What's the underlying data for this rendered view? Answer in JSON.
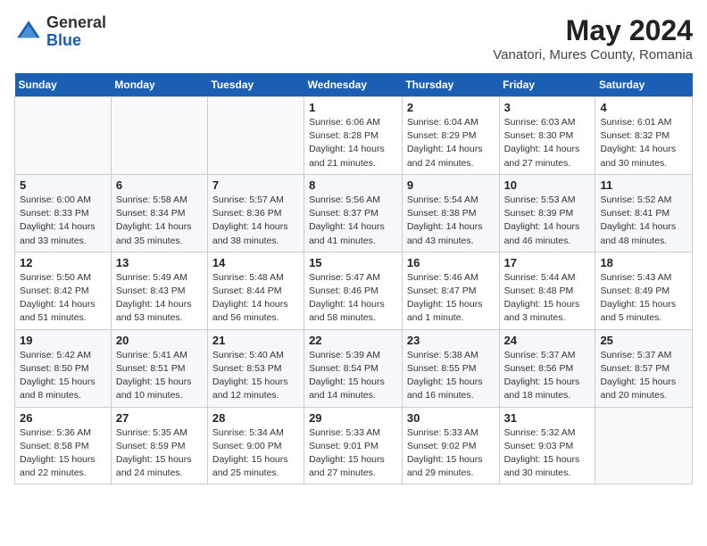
{
  "header": {
    "logo": {
      "general": "General",
      "blue": "Blue"
    },
    "title": "May 2024",
    "location": "Vanatori, Mures County, Romania"
  },
  "weekdays": [
    "Sunday",
    "Monday",
    "Tuesday",
    "Wednesday",
    "Thursday",
    "Friday",
    "Saturday"
  ],
  "weeks": [
    [
      null,
      null,
      null,
      {
        "day": "1",
        "sunrise": "Sunrise: 6:06 AM",
        "sunset": "Sunset: 8:28 PM",
        "daylight": "Daylight: 14 hours and 21 minutes."
      },
      {
        "day": "2",
        "sunrise": "Sunrise: 6:04 AM",
        "sunset": "Sunset: 8:29 PM",
        "daylight": "Daylight: 14 hours and 24 minutes."
      },
      {
        "day": "3",
        "sunrise": "Sunrise: 6:03 AM",
        "sunset": "Sunset: 8:30 PM",
        "daylight": "Daylight: 14 hours and 27 minutes."
      },
      {
        "day": "4",
        "sunrise": "Sunrise: 6:01 AM",
        "sunset": "Sunset: 8:32 PM",
        "daylight": "Daylight: 14 hours and 30 minutes."
      }
    ],
    [
      {
        "day": "5",
        "sunrise": "Sunrise: 6:00 AM",
        "sunset": "Sunset: 8:33 PM",
        "daylight": "Daylight: 14 hours and 33 minutes."
      },
      {
        "day": "6",
        "sunrise": "Sunrise: 5:58 AM",
        "sunset": "Sunset: 8:34 PM",
        "daylight": "Daylight: 14 hours and 35 minutes."
      },
      {
        "day": "7",
        "sunrise": "Sunrise: 5:57 AM",
        "sunset": "Sunset: 8:36 PM",
        "daylight": "Daylight: 14 hours and 38 minutes."
      },
      {
        "day": "8",
        "sunrise": "Sunrise: 5:56 AM",
        "sunset": "Sunset: 8:37 PM",
        "daylight": "Daylight: 14 hours and 41 minutes."
      },
      {
        "day": "9",
        "sunrise": "Sunrise: 5:54 AM",
        "sunset": "Sunset: 8:38 PM",
        "daylight": "Daylight: 14 hours and 43 minutes."
      },
      {
        "day": "10",
        "sunrise": "Sunrise: 5:53 AM",
        "sunset": "Sunset: 8:39 PM",
        "daylight": "Daylight: 14 hours and 46 minutes."
      },
      {
        "day": "11",
        "sunrise": "Sunrise: 5:52 AM",
        "sunset": "Sunset: 8:41 PM",
        "daylight": "Daylight: 14 hours and 48 minutes."
      }
    ],
    [
      {
        "day": "12",
        "sunrise": "Sunrise: 5:50 AM",
        "sunset": "Sunset: 8:42 PM",
        "daylight": "Daylight: 14 hours and 51 minutes."
      },
      {
        "day": "13",
        "sunrise": "Sunrise: 5:49 AM",
        "sunset": "Sunset: 8:43 PM",
        "daylight": "Daylight: 14 hours and 53 minutes."
      },
      {
        "day": "14",
        "sunrise": "Sunrise: 5:48 AM",
        "sunset": "Sunset: 8:44 PM",
        "daylight": "Daylight: 14 hours and 56 minutes."
      },
      {
        "day": "15",
        "sunrise": "Sunrise: 5:47 AM",
        "sunset": "Sunset: 8:46 PM",
        "daylight": "Daylight: 14 hours and 58 minutes."
      },
      {
        "day": "16",
        "sunrise": "Sunrise: 5:46 AM",
        "sunset": "Sunset: 8:47 PM",
        "daylight": "Daylight: 15 hours and 1 minute."
      },
      {
        "day": "17",
        "sunrise": "Sunrise: 5:44 AM",
        "sunset": "Sunset: 8:48 PM",
        "daylight": "Daylight: 15 hours and 3 minutes."
      },
      {
        "day": "18",
        "sunrise": "Sunrise: 5:43 AM",
        "sunset": "Sunset: 8:49 PM",
        "daylight": "Daylight: 15 hours and 5 minutes."
      }
    ],
    [
      {
        "day": "19",
        "sunrise": "Sunrise: 5:42 AM",
        "sunset": "Sunset: 8:50 PM",
        "daylight": "Daylight: 15 hours and 8 minutes."
      },
      {
        "day": "20",
        "sunrise": "Sunrise: 5:41 AM",
        "sunset": "Sunset: 8:51 PM",
        "daylight": "Daylight: 15 hours and 10 minutes."
      },
      {
        "day": "21",
        "sunrise": "Sunrise: 5:40 AM",
        "sunset": "Sunset: 8:53 PM",
        "daylight": "Daylight: 15 hours and 12 minutes."
      },
      {
        "day": "22",
        "sunrise": "Sunrise: 5:39 AM",
        "sunset": "Sunset: 8:54 PM",
        "daylight": "Daylight: 15 hours and 14 minutes."
      },
      {
        "day": "23",
        "sunrise": "Sunrise: 5:38 AM",
        "sunset": "Sunset: 8:55 PM",
        "daylight": "Daylight: 15 hours and 16 minutes."
      },
      {
        "day": "24",
        "sunrise": "Sunrise: 5:37 AM",
        "sunset": "Sunset: 8:56 PM",
        "daylight": "Daylight: 15 hours and 18 minutes."
      },
      {
        "day": "25",
        "sunrise": "Sunrise: 5:37 AM",
        "sunset": "Sunset: 8:57 PM",
        "daylight": "Daylight: 15 hours and 20 minutes."
      }
    ],
    [
      {
        "day": "26",
        "sunrise": "Sunrise: 5:36 AM",
        "sunset": "Sunset: 8:58 PM",
        "daylight": "Daylight: 15 hours and 22 minutes."
      },
      {
        "day": "27",
        "sunrise": "Sunrise: 5:35 AM",
        "sunset": "Sunset: 8:59 PM",
        "daylight": "Daylight: 15 hours and 24 minutes."
      },
      {
        "day": "28",
        "sunrise": "Sunrise: 5:34 AM",
        "sunset": "Sunset: 9:00 PM",
        "daylight": "Daylight: 15 hours and 25 minutes."
      },
      {
        "day": "29",
        "sunrise": "Sunrise: 5:33 AM",
        "sunset": "Sunset: 9:01 PM",
        "daylight": "Daylight: 15 hours and 27 minutes."
      },
      {
        "day": "30",
        "sunrise": "Sunrise: 5:33 AM",
        "sunset": "Sunset: 9:02 PM",
        "daylight": "Daylight: 15 hours and 29 minutes."
      },
      {
        "day": "31",
        "sunrise": "Sunrise: 5:32 AM",
        "sunset": "Sunset: 9:03 PM",
        "daylight": "Daylight: 15 hours and 30 minutes."
      },
      null
    ]
  ]
}
